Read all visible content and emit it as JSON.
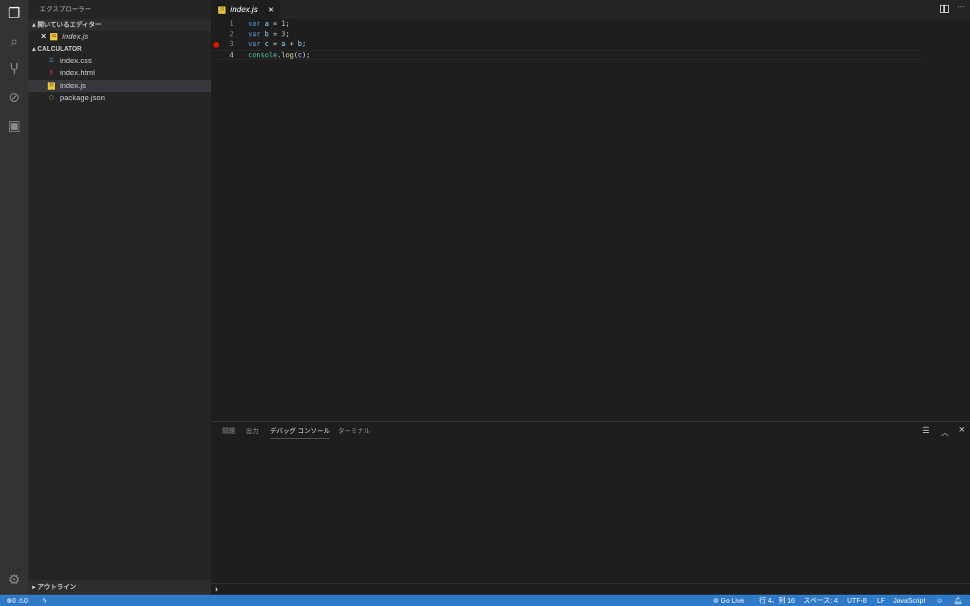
{
  "sidebar": {
    "title": "エクスプローラー",
    "open_editors": "開いているエディター",
    "open_files": [
      {
        "name": "index.js"
      }
    ],
    "folder": "CALCULATOR",
    "files": [
      "index.css",
      "index.html",
      "index.js",
      "package.json"
    ],
    "outline": "アウトライン"
  },
  "editor": {
    "tab": "index.js",
    "lines": [
      {
        "n": "1"
      },
      {
        "n": "2"
      },
      {
        "n": "3"
      },
      {
        "n": "4"
      }
    ],
    "breakpoint_line": 3
  },
  "panel": {
    "tabs": [
      "問題",
      "出力",
      "デバッグ コンソール",
      "ターミナル"
    ],
    "active": "デバッグ コンソール",
    "prompt": "›"
  },
  "status": {
    "errors": "0",
    "warnings": "0",
    "go_live": "Go Live",
    "position": "行 4、列 16",
    "spaces": "スペース: 4",
    "encoding": "UTF-8",
    "eol": "LF",
    "language": "JavaScript"
  },
  "colors": {
    "status_bar": "#2f7ac7",
    "breakpoint": "#e51400"
  }
}
